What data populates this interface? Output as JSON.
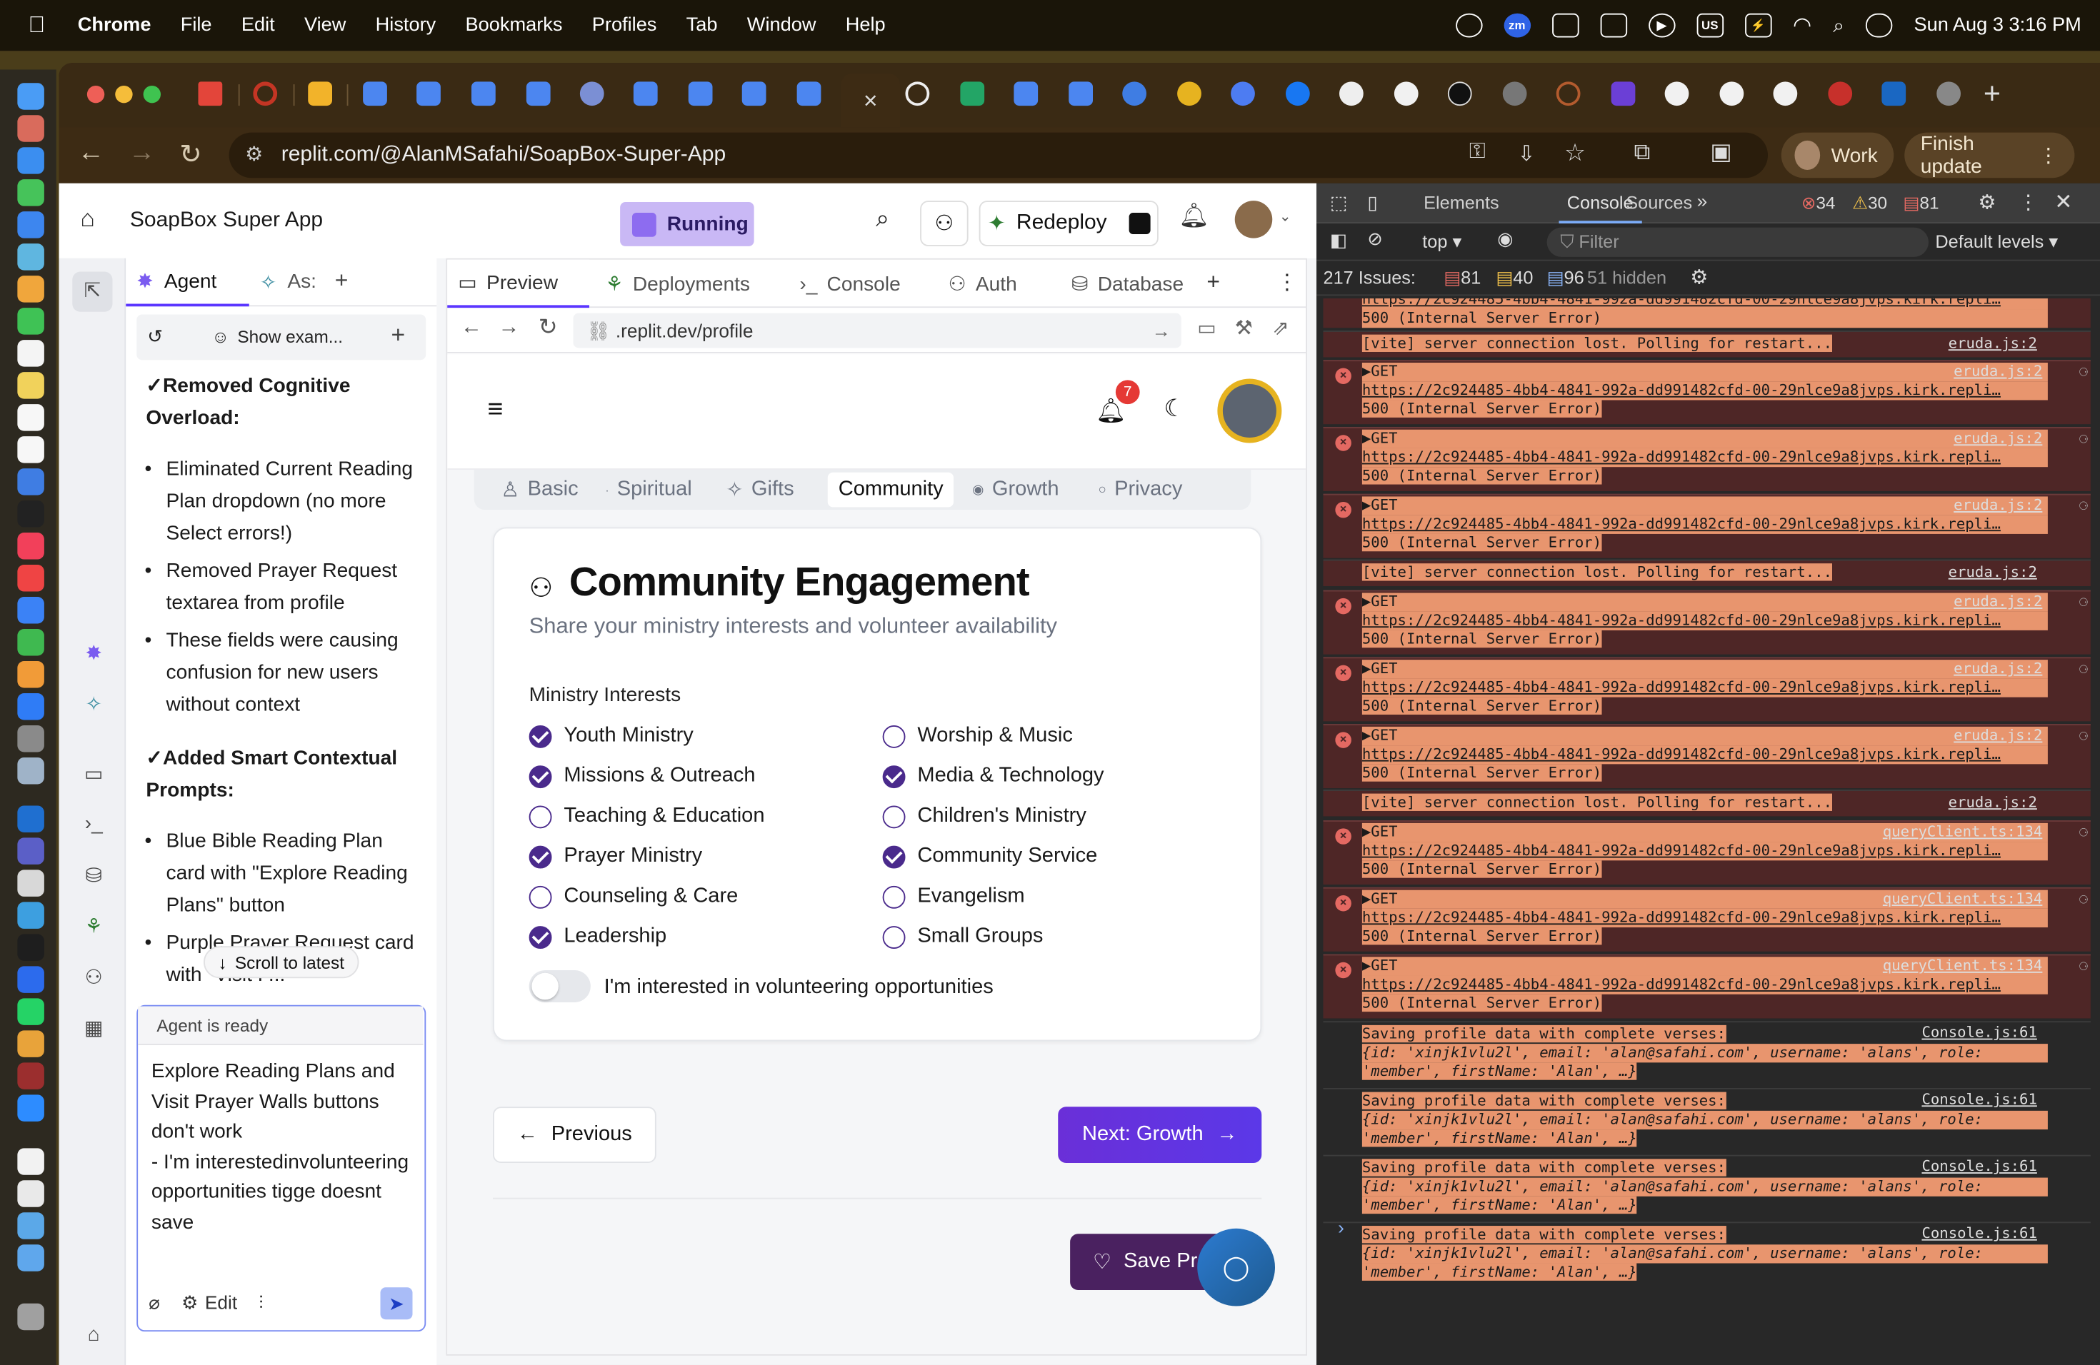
{
  "menubar": {
    "app": "Chrome",
    "items": [
      "File",
      "Edit",
      "View",
      "History",
      "Bookmarks",
      "Profiles",
      "Tab",
      "Window",
      "Help"
    ],
    "status_zm": "zm",
    "status_us": "US",
    "datetime": "Sun Aug 3  3:16 PM"
  },
  "browser": {
    "url": "replit.com/@AlanMSafahi/SoapBox-Super-App",
    "profile_label": "Work",
    "update_label": "Finish update",
    "active_tab_close": "×"
  },
  "replit": {
    "title": "SoapBox Super App",
    "status": "Running",
    "redeploy": "Redeploy"
  },
  "agent": {
    "tab_agent": "Agent",
    "tab_assistant": "As:",
    "show_examples": "Show exam...",
    "heading1": "✓Removed Cognitive Overload:",
    "bullets1": [
      "Eliminated Current Reading Plan dropdown (no more Select errors!)",
      "Removed Prayer Request textarea from profile",
      "These fields were causing confusion for new users without context"
    ],
    "heading2": "✓Added Smart Contextual Prompts:",
    "bullets2": [
      "Blue Bible Reading Plan card with \"Explore Reading Plans\" button",
      "Purple Prayer Request card with \"Visit P..."
    ],
    "scroll_latest": "Scroll to latest",
    "ready": "Agent is ready",
    "message": "Explore Reading Plans and Visit Prayer Walls buttons don't work\n- I'm interestedinvolunteering opportunities tigge doesnt save",
    "edit_label": "Edit"
  },
  "preview": {
    "tabs": [
      "Preview",
      "Deployments",
      "Console",
      "Auth",
      "Database"
    ],
    "address": ".replit.dev/profile",
    "notif_count": "7",
    "section_tabs": [
      "Basic",
      "Spiritual",
      "Gifts",
      "Community",
      "Growth",
      "Privacy"
    ],
    "active_section": "Community",
    "card_title": "Community Engagement",
    "card_subtitle": "Share your ministry interests and volunteer availability",
    "ministry_label": "Ministry Interests",
    "ministries_left": [
      {
        "label": "Youth Ministry",
        "checked": true
      },
      {
        "label": "Missions & Outreach",
        "checked": true
      },
      {
        "label": "Teaching & Education",
        "checked": false
      },
      {
        "label": "Prayer Ministry",
        "checked": true
      },
      {
        "label": "Counseling & Care",
        "checked": false
      },
      {
        "label": "Leadership",
        "checked": true
      }
    ],
    "ministries_right": [
      {
        "label": "Worship & Music",
        "checked": false
      },
      {
        "label": "Media & Technology",
        "checked": true
      },
      {
        "label": "Children's Ministry",
        "checked": false
      },
      {
        "label": "Community Service",
        "checked": true
      },
      {
        "label": "Evangelism",
        "checked": false
      },
      {
        "label": "Small Groups",
        "checked": false
      }
    ],
    "volunteer_label": "I'm interested in volunteering opportunities",
    "volunteer_on": false,
    "prev_label": "Previous",
    "next_label": "Next: Growth",
    "save_label": "Save Pr"
  },
  "devtools": {
    "tabs": [
      "Elements",
      "Console",
      "Sources"
    ],
    "errors": "34",
    "warnings": "30",
    "messages": "81",
    "context": "top",
    "filter_placeholder": "Filter",
    "levels": "Default levels",
    "issues_label": "217 Issues:",
    "issues_err": "81",
    "issues_warn": "40",
    "issues_info": "96",
    "hidden": "51 hidden",
    "err_url": "https://2c924485-4bb4-4841-992a-dd991482cfd-00-29nlce9a8jvps.kirk.repli…",
    "err_status": "500 (Internal Server Error)",
    "vite_msg": "[vite] server connection lost. Polling for restart...",
    "src_eruda": "eruda.js:2",
    "src_query": "queryClient.ts:134",
    "src_console": "Console.js:61",
    "save_msg": "Saving profile data with complete verses:",
    "save_obj1": "{id: 'xinjk1vlu2l', email: 'alan@safahi.com', username: 'alans', role:",
    "save_obj2": "'member', firstName: 'Alan', …}"
  },
  "colors": {
    "accent_purple": "#5b38e8",
    "check_purple": "#4a2a8c",
    "running_bg": "#c9b8f5",
    "error_bg": "#4e2626"
  }
}
